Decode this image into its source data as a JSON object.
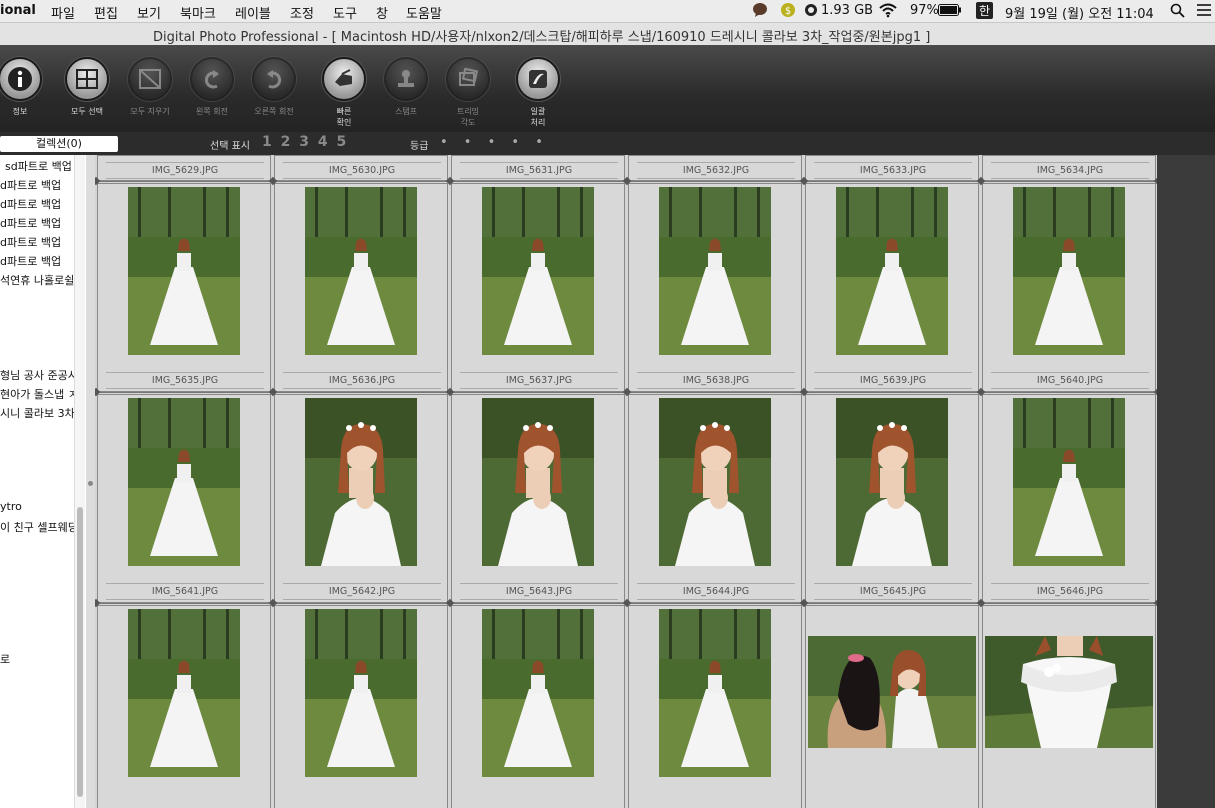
{
  "menubar": {
    "app": "ional",
    "items": [
      "파일",
      "편집",
      "보기",
      "북마크",
      "레이블",
      "조정",
      "도구",
      "창",
      "도움말"
    ],
    "memory": "1.93 GB",
    "battery": "97%",
    "input_method": "한",
    "datetime": "9월 19일 (월) 오전  11:04"
  },
  "window": {
    "title": "Digital Photo Professional - [ Macintosh HD/사용자/nlxon2/데스크탑/해피하루 스냅/160910 드레시니 콜라보 3차_작업중/원본jpg1 ]"
  },
  "toolbar": {
    "buttons": [
      {
        "name": "info",
        "label": "정보",
        "icon": "info-icon",
        "enabled": true
      },
      {
        "name": "select-all",
        "label": "모두 선택",
        "icon": "grid-icon",
        "enabled": true
      },
      {
        "name": "clear-all",
        "label": "모두 지우기",
        "icon": "grid-clear-icon",
        "enabled": false
      },
      {
        "name": "rotate-left",
        "label": "왼쪽 회전",
        "icon": "rotate-left-icon",
        "enabled": false
      },
      {
        "name": "rotate-right",
        "label": "오른쪽 회전",
        "icon": "rotate-right-icon",
        "enabled": false
      },
      {
        "name": "quick-check",
        "label": "빠른\n확인",
        "icon": "hand-icon",
        "enabled": true
      },
      {
        "name": "stamp",
        "label": "스탬프",
        "icon": "stamp-icon",
        "enabled": false
      },
      {
        "name": "trim",
        "label": "트리밍\n각도",
        "icon": "trim-icon",
        "enabled": false
      },
      {
        "name": "batch",
        "label": "일괄\n처리",
        "icon": "batch-icon",
        "enabled": true
      }
    ]
  },
  "filterbar": {
    "collection": "컬렉션(0)",
    "selection_label": "선택 표시",
    "selection_numbers": "1 2 3 4 5",
    "grade_label": "등급",
    "grade_dots": "• • • • •"
  },
  "folders": [
    "sd파트로 백업",
    "d파트로 백업",
    "d파트로 백업",
    "d파트로 백업",
    "d파트로 백업",
    "d파트로 백업",
    "석연휴 나홀로쉴",
    "형님 공사 준공시",
    "현아가 돌스냅 ㅈ",
    "시니 콜라보 3차",
    "ytro",
    "이 친구 셀프웨딩",
    "로"
  ],
  "grid": {
    "top_captions": [
      "IMG_5629.JPG",
      "IMG_5630.JPG",
      "IMG_5631.JPG",
      "IMG_5632.JPG",
      "IMG_5633.JPG",
      "IMG_5634.JPG"
    ],
    "rows": [
      [
        {
          "file": "IMG_5635.JPG",
          "kind": "portrait-full"
        },
        {
          "file": "IMG_5636.JPG",
          "kind": "portrait-full"
        },
        {
          "file": "IMG_5637.JPG",
          "kind": "portrait-full"
        },
        {
          "file": "IMG_5638.JPG",
          "kind": "portrait-full"
        },
        {
          "file": "IMG_5639.JPG",
          "kind": "portrait-full"
        },
        {
          "file": "IMG_5640.JPG",
          "kind": "portrait-full"
        }
      ],
      [
        {
          "file": "IMG_5641.JPG",
          "kind": "portrait-full"
        },
        {
          "file": "IMG_5642.JPG",
          "kind": "portrait-close"
        },
        {
          "file": "IMG_5643.JPG",
          "kind": "portrait-close"
        },
        {
          "file": "IMG_5644.JPG",
          "kind": "portrait-close"
        },
        {
          "file": "IMG_5645.JPG",
          "kind": "portrait-close"
        },
        {
          "file": "IMG_5646.JPG",
          "kind": "portrait-full"
        }
      ],
      [
        {
          "file": "",
          "kind": "portrait-full"
        },
        {
          "file": "",
          "kind": "portrait-full"
        },
        {
          "file": "",
          "kind": "portrait-full"
        },
        {
          "file": "",
          "kind": "portrait-full"
        },
        {
          "file": "",
          "kind": "landscape-two"
        },
        {
          "file": "",
          "kind": "landscape-dress"
        }
      ]
    ]
  }
}
